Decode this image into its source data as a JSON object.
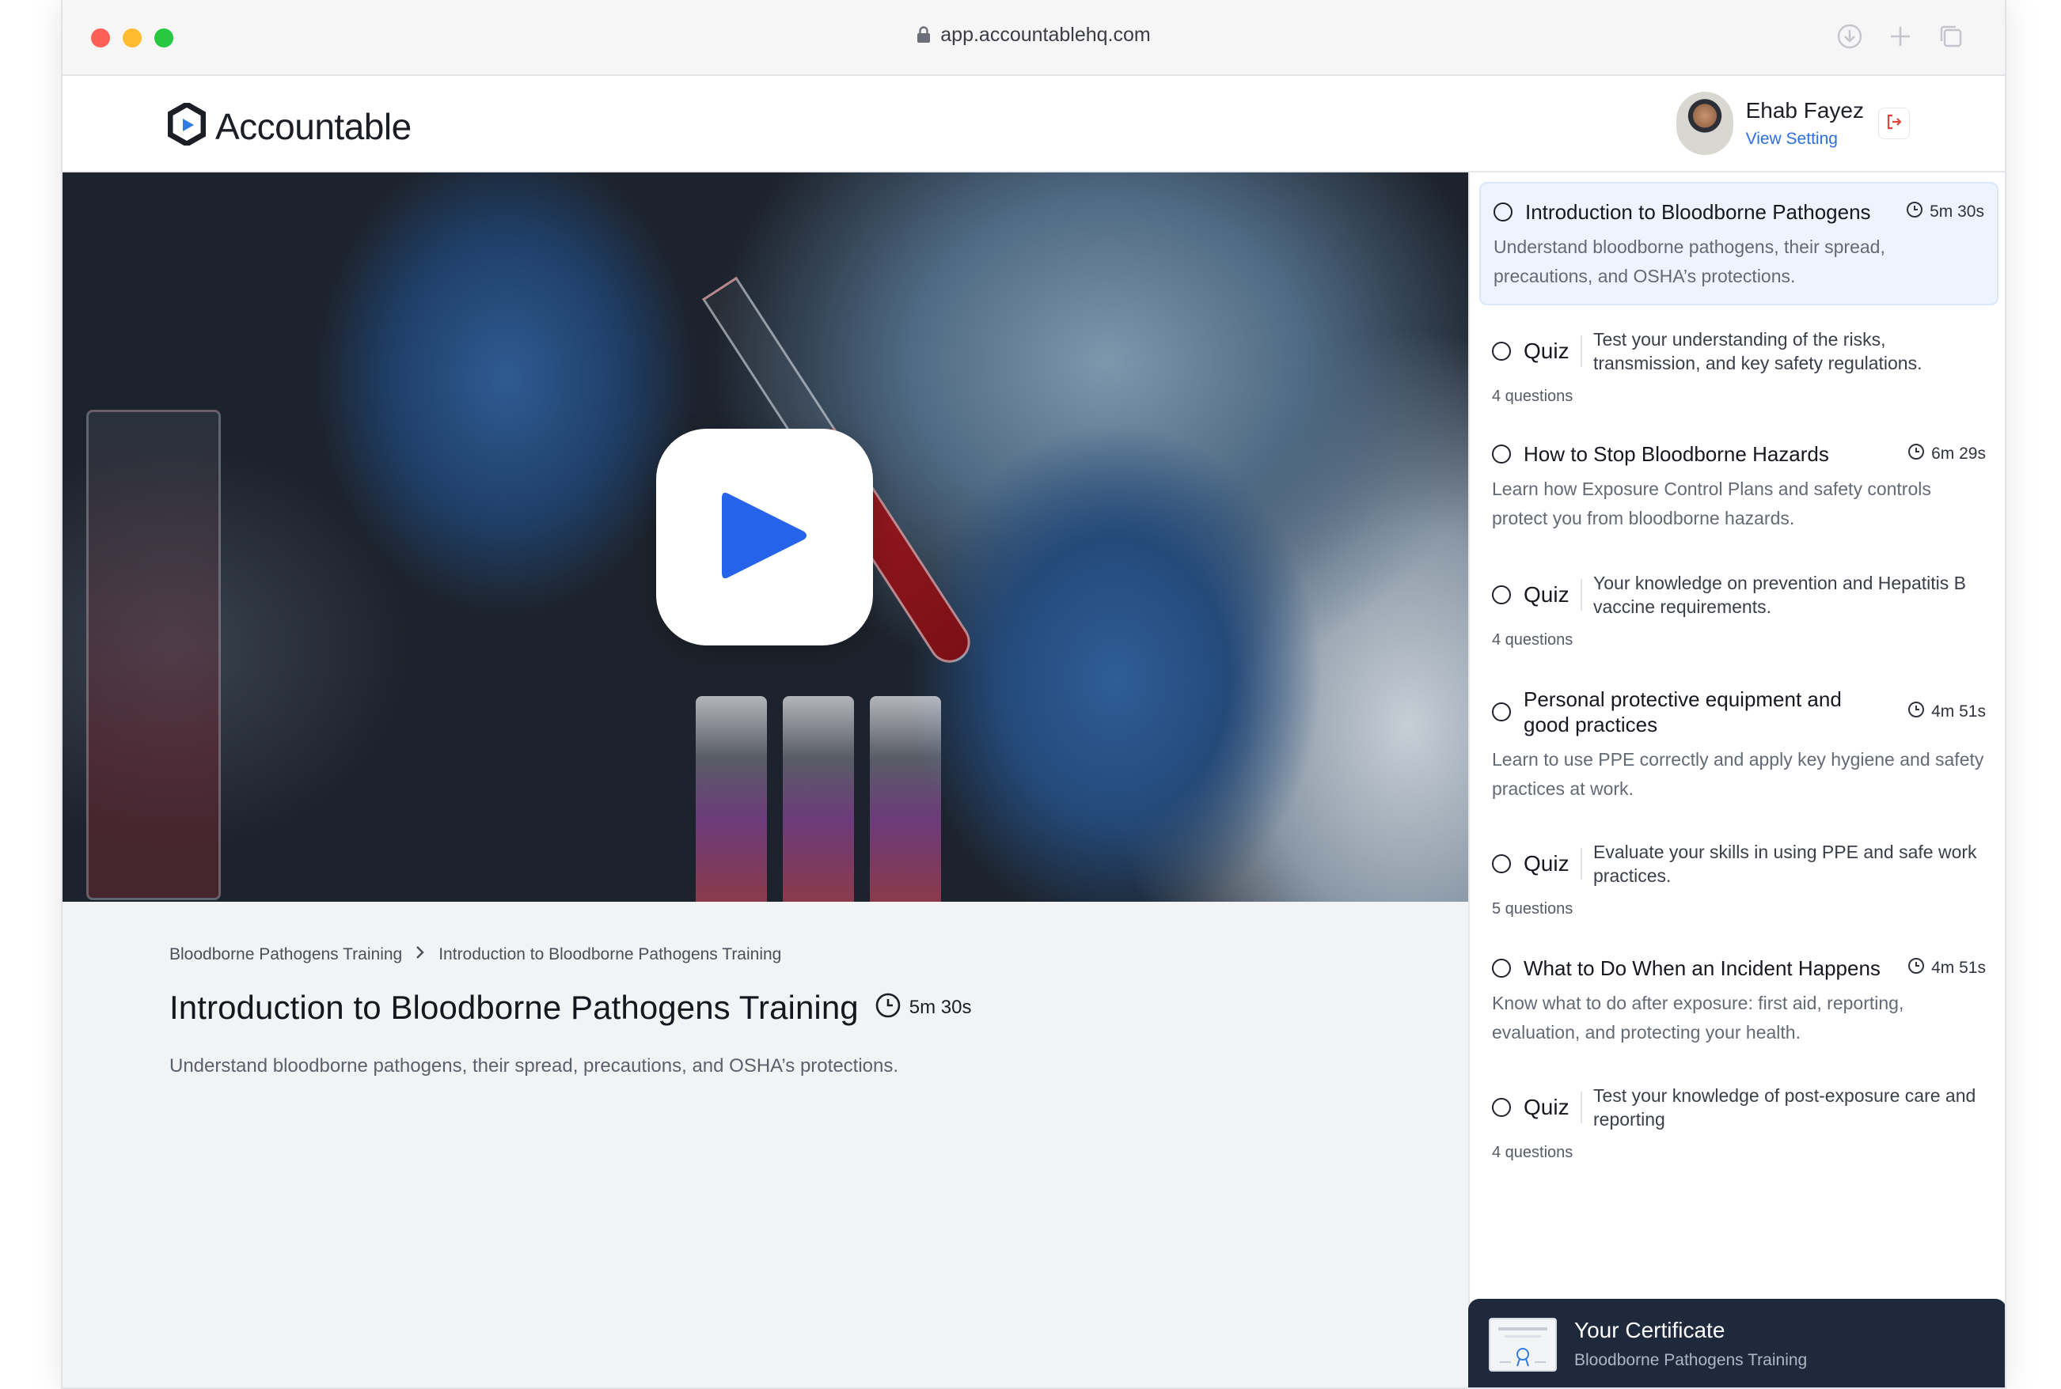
{
  "browser": {
    "url": "app.accountablehq.com"
  },
  "header": {
    "logo_text": "Accountable",
    "user_name": "Ehab Fayez",
    "user_link": "View Setting"
  },
  "main": {
    "breadcrumb": [
      "Bloodborne Pathogens Training",
      "Introduction to Bloodborne Pathogens Training"
    ],
    "title": "Introduction to Bloodborne Pathogens Training",
    "duration": "5m 30s",
    "description": "Understand bloodborne pathogens, their spread, precautions, and OSHA’s protections."
  },
  "sidebar": {
    "items": [
      {
        "type": "lesson",
        "title": "Introduction to Bloodborne Pathogens",
        "duration": "5m 30s",
        "description": "Understand bloodborne pathogens, their spread, precautions, and OSHA’s protections.",
        "active": true
      },
      {
        "type": "quiz",
        "label": "Quiz",
        "description": "Test your understanding of the risks, transmission, and key safety regulations.",
        "meta": "4 questions"
      },
      {
        "type": "lesson",
        "title": "How to Stop Bloodborne Hazards",
        "duration": "6m 29s",
        "description": "Learn how Exposure Control Plans and safety controls protect you from bloodborne hazards."
      },
      {
        "type": "quiz",
        "label": "Quiz",
        "description": "Your knowledge on prevention and Hepatitis B vaccine requirements.",
        "meta": "4 questions"
      },
      {
        "type": "lesson",
        "title": "Personal protective equipment and good practices",
        "duration": "4m 51s",
        "description": "Learn to use PPE correctly and apply key hygiene and safety practices at work."
      },
      {
        "type": "quiz",
        "label": "Quiz",
        "description": "Evaluate your skills in using PPE and safe work practices.",
        "meta": "5 questions"
      },
      {
        "type": "lesson",
        "title": "What to Do When an Incident Happens",
        "duration": "4m 51s",
        "description": "Know what to do after exposure: first aid, reporting, evaluation, and protecting your health."
      },
      {
        "type": "quiz",
        "label": "Quiz",
        "description": "Test your knowledge of post-exposure care and reporting",
        "meta": "4 questions"
      }
    ]
  },
  "certificate": {
    "title": "Your Certificate",
    "subtitle": "Bloodborne Pathogens Training"
  },
  "colors": {
    "accent": "#2563eb",
    "active_bg": "#eef4fd",
    "certificate_bg": "#1e2a3b",
    "logout": "#e0463c"
  }
}
